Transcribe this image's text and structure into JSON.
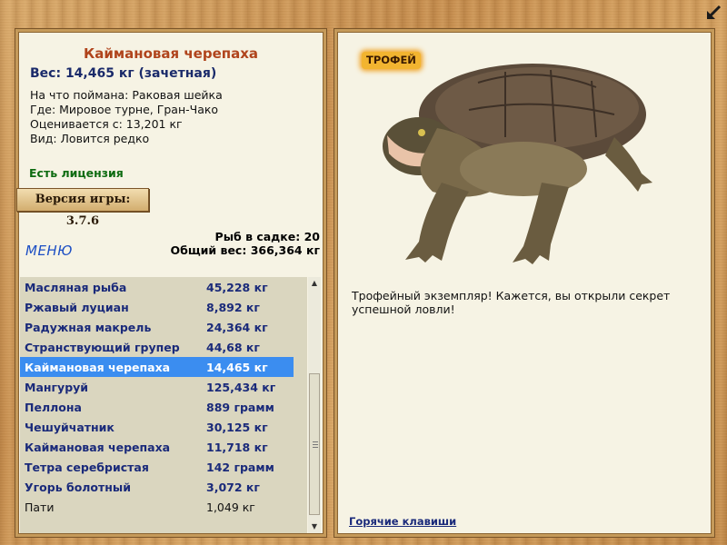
{
  "fish": {
    "title": "Каймановая черепаха",
    "weight": "Вес: 14,465 кг (зачетная)",
    "caught_on": "На что поймана: Раковая шейка",
    "location": "Где: Мировое турне, Гран-Чако",
    "valued_from": "Оценивается с: 13,201 кг",
    "kind": "Вид: Ловится редко"
  },
  "license": "Есть лицензия",
  "version": "Версия игры: 3.7.6",
  "menu_label": "МЕНЮ",
  "stats": {
    "fish_in_keepnet": "Рыб в садке: 20",
    "total_weight": "Общий вес: 366,364 кг"
  },
  "catch_list": [
    {
      "name": "Масляная рыба",
      "weight": "45,228 кг"
    },
    {
      "name": "Ржавый луциан",
      "weight": "8,892 кг"
    },
    {
      "name": "Радужная макрель",
      "weight": "24,364 кг"
    },
    {
      "name": "Странствующий групер",
      "weight": "44,68 кг"
    },
    {
      "name": "Каймановая черепаха",
      "weight": "14,465 кг"
    },
    {
      "name": "Мангуруй",
      "weight": "125,434 кг"
    },
    {
      "name": "Пеллона",
      "weight": "889 грамм"
    },
    {
      "name": "Чешуйчатник",
      "weight": "30,125 кг"
    },
    {
      "name": "Каймановая черепаха",
      "weight": "11,718 кг"
    },
    {
      "name": "Тетра серебристая",
      "weight": "142 грамм"
    },
    {
      "name": "Угорь болотный",
      "weight": "3,072 кг"
    },
    {
      "name": "Пати",
      "weight": "1,049 кг"
    }
  ],
  "selected_index": 4,
  "trophy_badge": "ТРОФЕЙ",
  "description": "Трофейный экземпляр! Кажется, вы открыли секрет успешной ловли!",
  "hotkeys_link": "Горячие клавиши",
  "icons": {
    "back": "back-arrow-icon",
    "scroll_up": "scroll-up-icon",
    "scroll_down": "scroll-down-icon"
  },
  "colors": {
    "title": "#b0441c",
    "accent_blue": "#1a2a7a",
    "selection": "#3b8df0",
    "license_green": "#0d6b10",
    "trophy_gold": "#f2b430"
  }
}
